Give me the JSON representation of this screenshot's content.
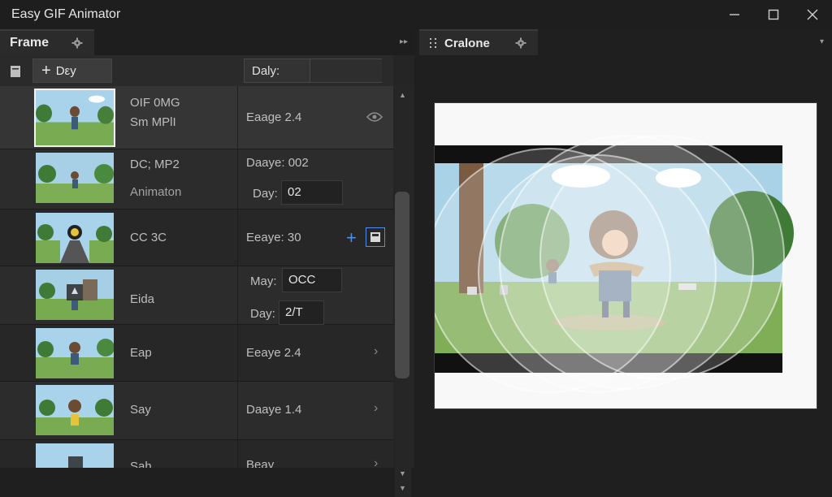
{
  "window": {
    "title": "Easy GIF Animator"
  },
  "left_panel": {
    "tab_label": "Frame",
    "toolbar": {
      "add_label": "Dεy",
      "delay_label": "Daly:"
    },
    "frames": [
      {
        "text1": "OIF 0MG",
        "text2": "Sm MPlI",
        "delay": "Eaage 2.4",
        "selected": true
      },
      {
        "text1": "DC; MP2",
        "text2": "Animaton",
        "delay": "Daaye: 002",
        "delay2_label": "Day:",
        "delay2_value": "02"
      },
      {
        "text1": "CC 3C",
        "delay": "Eeaye: 30"
      },
      {
        "text1": "Eida",
        "may_label": "May:",
        "may_value": "OCC",
        "day_label": "Day:",
        "day_value": "2/T"
      },
      {
        "text1": "Eap",
        "delay": "Eeaye 2.4"
      },
      {
        "text1": "Say",
        "delay": "Daaye 1.4"
      },
      {
        "text1": "Sah",
        "delay": "Beay"
      }
    ]
  },
  "right_panel": {
    "tab_label": "Cralone"
  }
}
